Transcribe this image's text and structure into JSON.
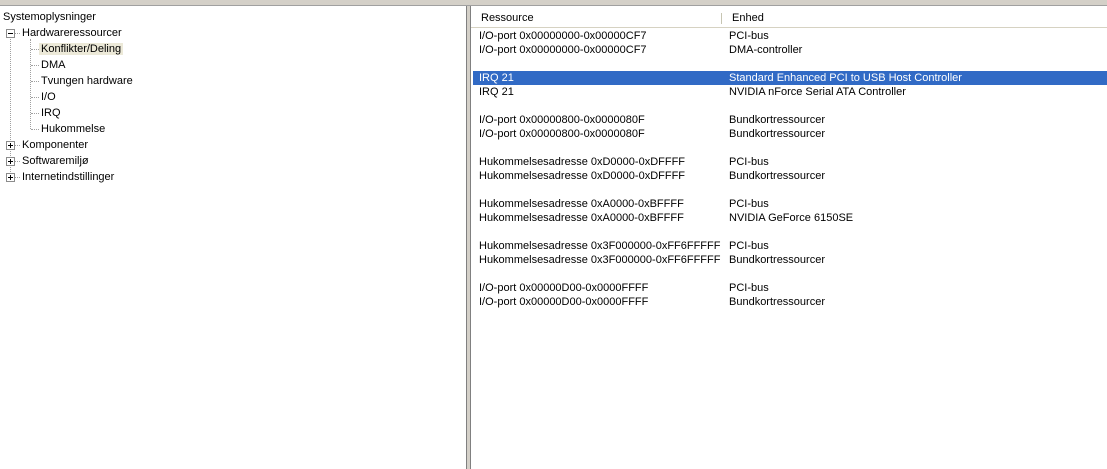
{
  "tree": {
    "root": "Systemoplysninger",
    "hardware": "Hardwareressourcer",
    "hardware_children": [
      "Konflikter/Deling",
      "DMA",
      "Tvungen hardware",
      "I/O",
      "IRQ",
      "Hukommelse"
    ],
    "components": "Komponenter",
    "software": "Softwaremiljø",
    "internet": "Internetindstillinger"
  },
  "list": {
    "headers": {
      "resource": "Ressource",
      "device": "Enhed"
    },
    "rows": [
      {
        "resource": "I/O-port 0x00000000-0x00000CF7",
        "device": "PCI-bus"
      },
      {
        "resource": "I/O-port 0x00000000-0x00000CF7",
        "device": "DMA-controller"
      },
      {
        "resource": "",
        "device": ""
      },
      {
        "resource": "IRQ 21",
        "device": "Standard Enhanced PCI to USB Host Controller"
      },
      {
        "resource": "IRQ 21",
        "device": "NVIDIA nForce Serial ATA Controller"
      },
      {
        "resource": "",
        "device": ""
      },
      {
        "resource": "I/O-port 0x00000800-0x0000080F",
        "device": "Bundkortressourcer"
      },
      {
        "resource": "I/O-port 0x00000800-0x0000080F",
        "device": "Bundkortressourcer"
      },
      {
        "resource": "",
        "device": ""
      },
      {
        "resource": "Hukommelsesadresse 0xD0000-0xDFFFF",
        "device": "PCI-bus"
      },
      {
        "resource": "Hukommelsesadresse 0xD0000-0xDFFFF",
        "device": "Bundkortressourcer"
      },
      {
        "resource": "",
        "device": ""
      },
      {
        "resource": "Hukommelsesadresse 0xA0000-0xBFFFF",
        "device": "PCI-bus"
      },
      {
        "resource": "Hukommelsesadresse 0xA0000-0xBFFFF",
        "device": "NVIDIA GeForce 6150SE"
      },
      {
        "resource": "",
        "device": ""
      },
      {
        "resource": "Hukommelsesadresse 0x3F000000-0xFF6FFFFF",
        "device": "PCI-bus"
      },
      {
        "resource": "Hukommelsesadresse 0x3F000000-0xFF6FFFFF",
        "device": "Bundkortressourcer"
      },
      {
        "resource": "",
        "device": ""
      },
      {
        "resource": "I/O-port 0x00000D00-0x0000FFFF",
        "device": "PCI-bus"
      },
      {
        "resource": "I/O-port 0x00000D00-0x0000FFFF",
        "device": "Bundkortressourcer"
      }
    ]
  },
  "colors": {
    "selection": "#316ac5",
    "inactive_selection": "#ece9d8"
  }
}
